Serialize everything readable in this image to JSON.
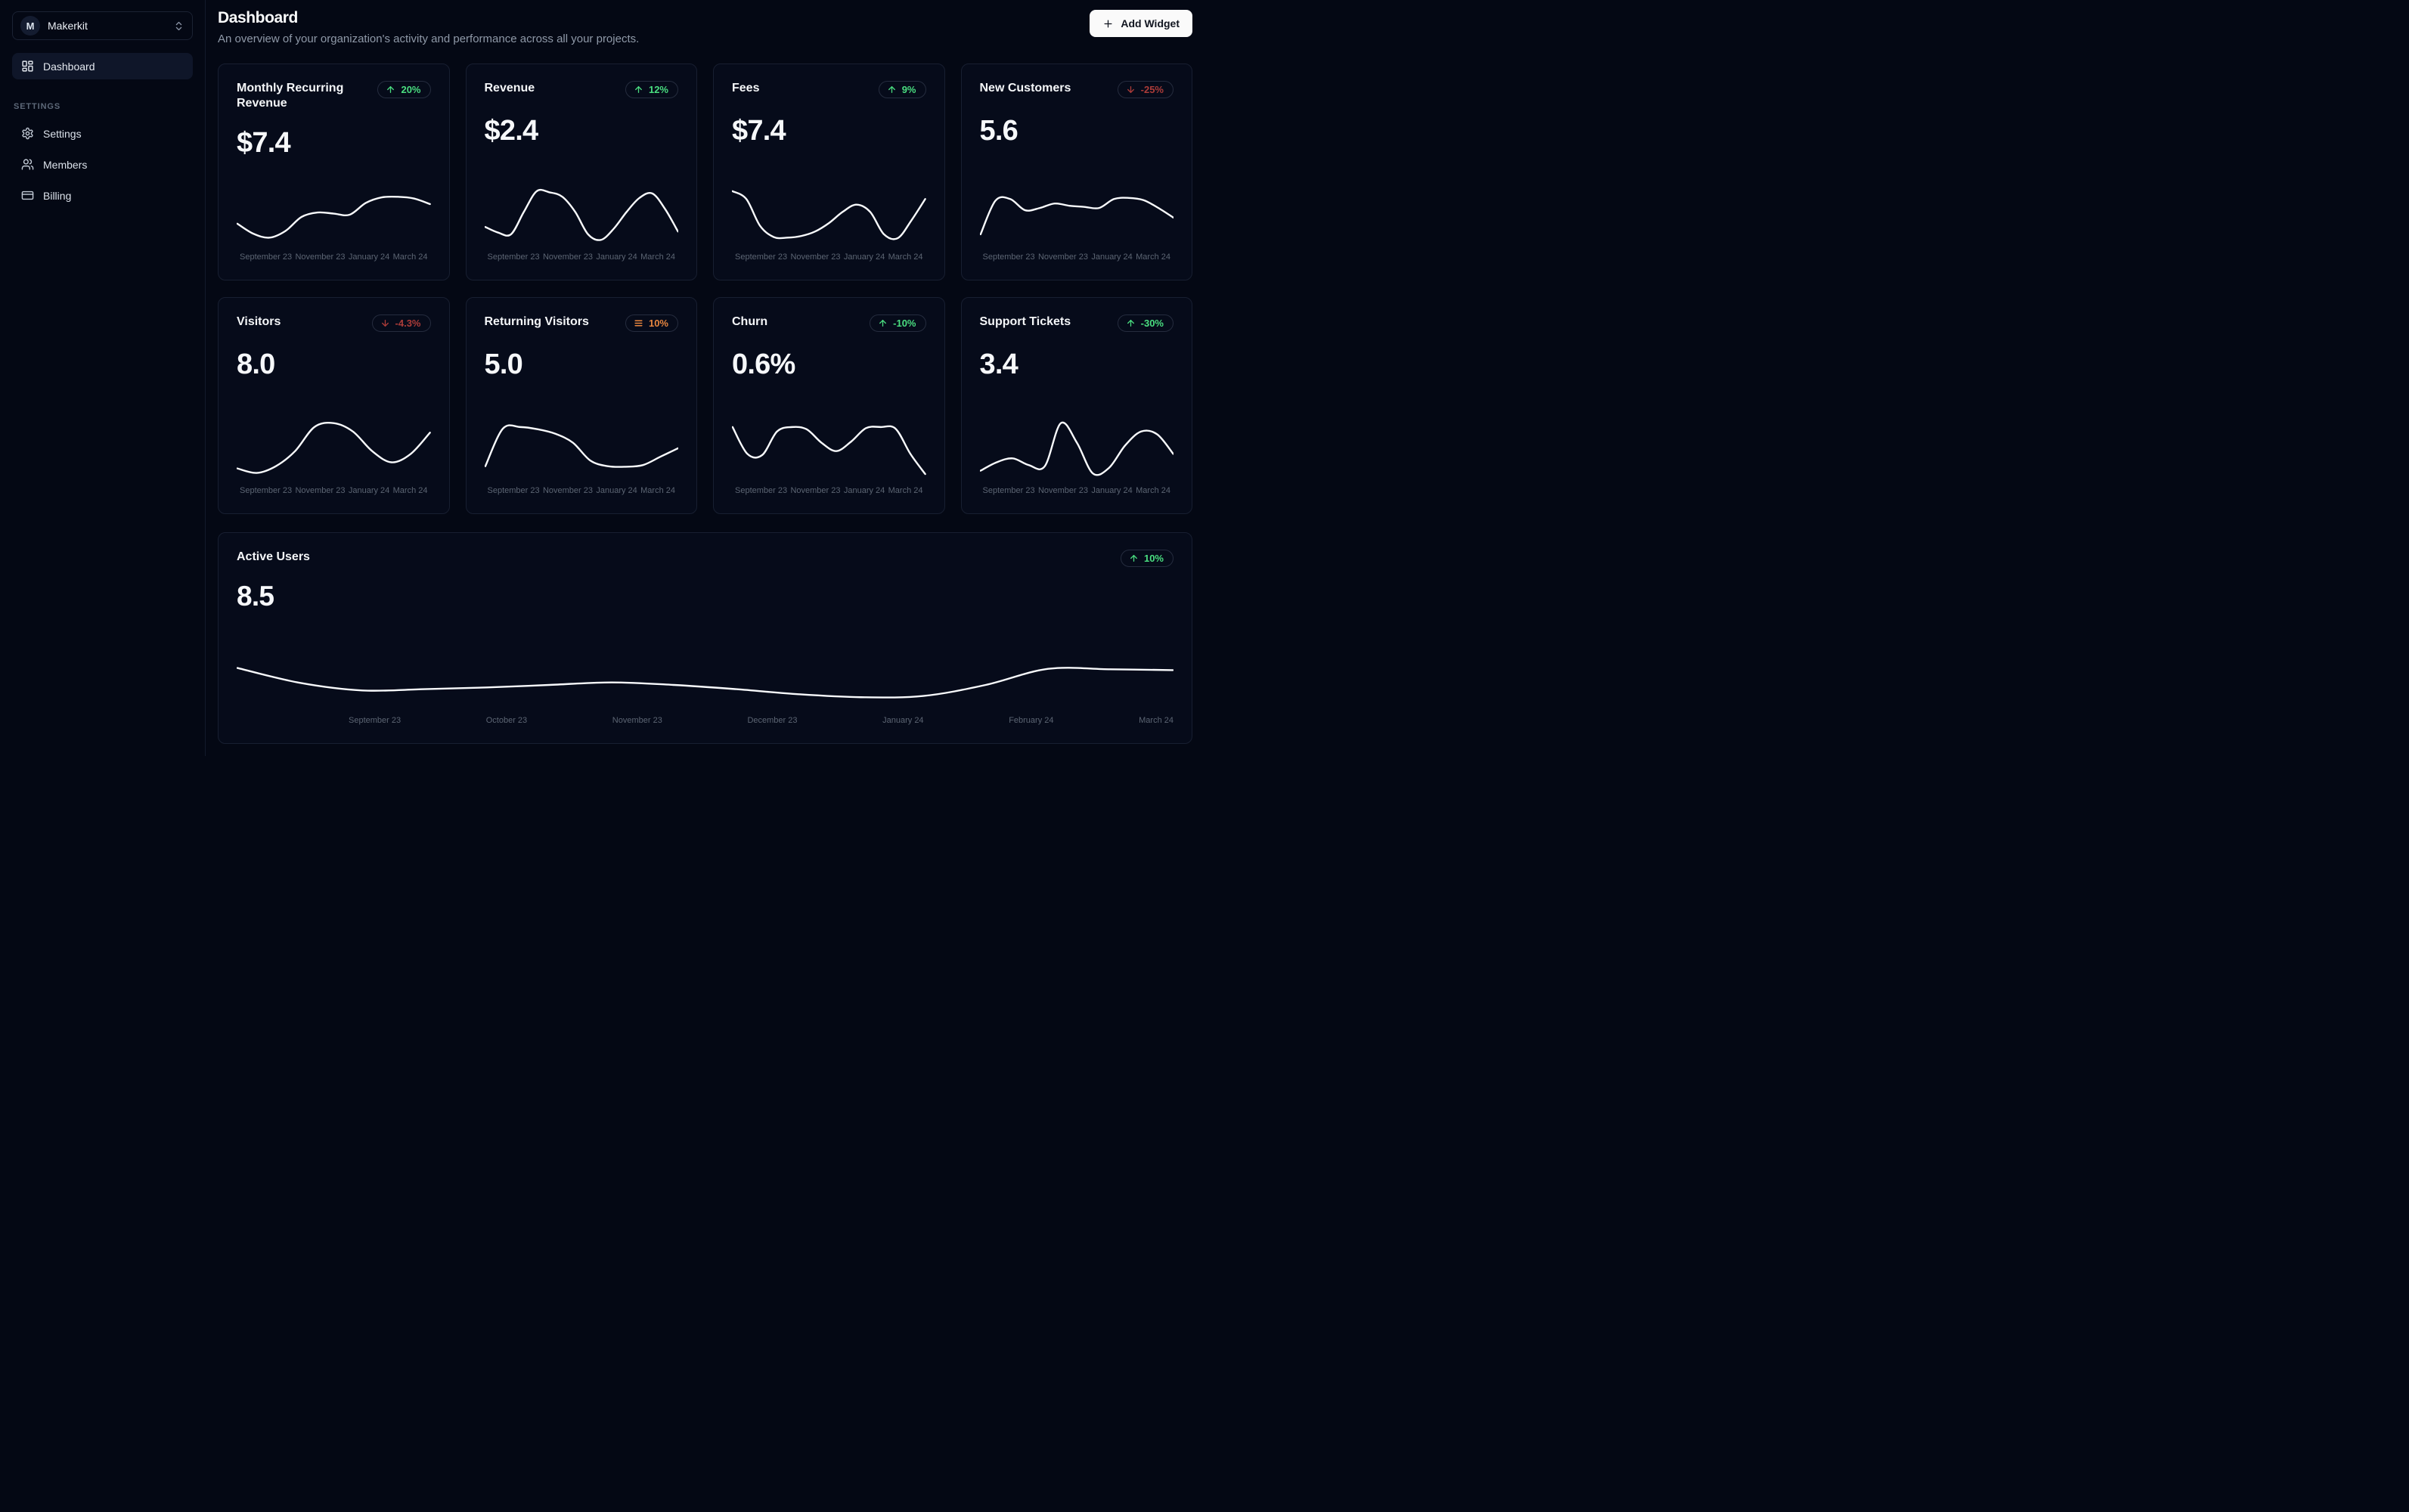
{
  "sidebar": {
    "workspace": {
      "initial": "M",
      "name": "Makerkit"
    },
    "nav_items": [
      {
        "label": "Dashboard"
      }
    ],
    "settings_heading": "SETTINGS",
    "settings_items": [
      {
        "label": "Settings"
      },
      {
        "label": "Members"
      },
      {
        "label": "Billing"
      }
    ]
  },
  "header": {
    "title": "Dashboard",
    "subtitle": "An overview of your organization's activity and performance across all your projects.",
    "add_widget_label": "Add Widget"
  },
  "colors": {
    "positive": "#4ade80",
    "negative": "#ac3c39",
    "neutral": "#e8863f",
    "line": "#f8fafc",
    "background": "#040814",
    "card_background": "#060b1a"
  },
  "chart_data": [
    {
      "type": "line",
      "size": "small",
      "title": "Monthly Recurring Revenue",
      "value": "$7.4",
      "trend": {
        "icon": "arrow-up",
        "label": "20%",
        "sentiment": "positive"
      },
      "categories": [
        "September 23",
        "November 23",
        "January 24",
        "March 24"
      ],
      "values": [
        34,
        16,
        9,
        21,
        46,
        54,
        52,
        50,
        71,
        81,
        82,
        79,
        69
      ]
    },
    {
      "type": "line",
      "size": "small",
      "title": "Revenue",
      "value": "$2.4",
      "trend": {
        "icon": "arrow-up",
        "label": "12%",
        "sentiment": "positive"
      },
      "categories": [
        "September 23",
        "November 23",
        "January 24",
        "March 24"
      ],
      "values": [
        28,
        18,
        15,
        55,
        92,
        90,
        82,
        55,
        15,
        5,
        25,
        55,
        80,
        88,
        60,
        20
      ]
    },
    {
      "type": "line",
      "size": "small",
      "title": "Fees",
      "value": "$7.4",
      "trend": {
        "icon": "arrow-up",
        "label": "9%",
        "sentiment": "positive"
      },
      "categories": [
        "September 23",
        "November 23",
        "January 24",
        "March 24"
      ],
      "values": [
        92,
        78,
        30,
        10,
        9,
        12,
        20,
        35,
        55,
        68,
        55,
        15,
        8,
        40,
        78
      ]
    },
    {
      "type": "line",
      "size": "small",
      "title": "New Customers",
      "value": "5.6",
      "trend": {
        "icon": "arrow-down",
        "label": "-25%",
        "sentiment": "negative"
      },
      "categories": [
        "September 23",
        "November 23",
        "January 24",
        "March 24"
      ],
      "values": [
        15,
        75,
        78,
        58,
        62,
        70,
        66,
        64,
        62,
        78,
        80,
        76,
        62,
        45
      ]
    },
    {
      "type": "line",
      "size": "small",
      "title": "Visitors",
      "value": "8.0",
      "trend": {
        "icon": "arrow-down",
        "label": "-4.3%",
        "sentiment": "negative"
      },
      "categories": [
        "September 23",
        "November 23",
        "January 24",
        "March 24"
      ],
      "values": [
        14,
        6,
        18,
        45,
        88,
        95,
        80,
        45,
        25,
        40,
        78
      ]
    },
    {
      "type": "line",
      "size": "small",
      "title": "Returning Visitors",
      "value": "5.0",
      "trend": {
        "icon": "menu",
        "label": "10%",
        "sentiment": "neutral"
      },
      "categories": [
        "September 23",
        "November 23",
        "January 24",
        "March 24"
      ],
      "values": [
        18,
        85,
        88,
        84,
        76,
        60,
        28,
        18,
        17,
        20,
        35,
        50
      ]
    },
    {
      "type": "line",
      "size": "small",
      "title": "Churn",
      "value": "0.6%",
      "trend": {
        "icon": "arrow-up",
        "label": "-10%",
        "sentiment": "positive"
      },
      "categories": [
        "September 23",
        "November 23",
        "January 24",
        "March 24"
      ],
      "values": [
        88,
        40,
        38,
        80,
        88,
        84,
        60,
        45,
        62,
        86,
        88,
        85,
        40,
        4
      ]
    },
    {
      "type": "line",
      "size": "small",
      "title": "Support Tickets",
      "value": "3.4",
      "trend": {
        "icon": "arrow-up",
        "label": "-30%",
        "sentiment": "positive"
      },
      "categories": [
        "September 23",
        "November 23",
        "January 24",
        "March 24"
      ],
      "values": [
        10,
        25,
        32,
        20,
        18,
        95,
        60,
        5,
        15,
        55,
        80,
        75,
        40
      ]
    },
    {
      "type": "line",
      "size": "wide",
      "title": "Active Users",
      "value": "8.5",
      "trend": {
        "icon": "arrow-up",
        "label": "10%",
        "sentiment": "positive"
      },
      "categories": [
        "September 23",
        "October 23",
        "November 23",
        "December 23",
        "January 24",
        "February 24",
        "March 24"
      ],
      "values": [
        90,
        55,
        37,
        40,
        44,
        50,
        56,
        50,
        40,
        28,
        21,
        24,
        50,
        88,
        87,
        85
      ]
    }
  ]
}
